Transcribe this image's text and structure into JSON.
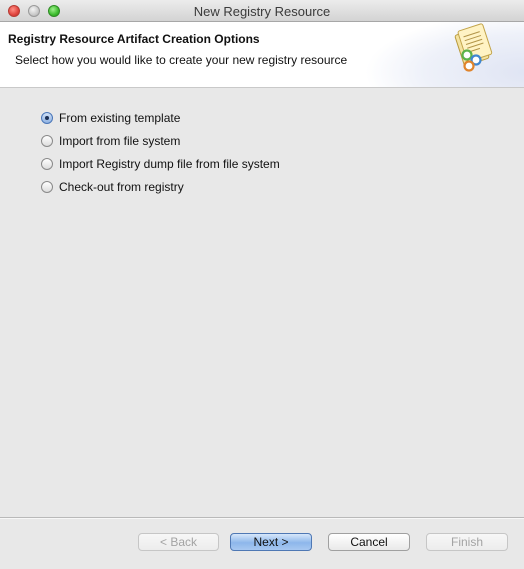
{
  "window": {
    "title": "New Registry Resource"
  },
  "header": {
    "title": "Registry Resource Artifact Creation Options",
    "description": "Select how you would like to create your new registry resource",
    "icon": "registry-documents-icon"
  },
  "options": [
    {
      "label": "From existing template",
      "selected": true
    },
    {
      "label": "Import from file system",
      "selected": false
    },
    {
      "label": "Import Registry dump file from file system",
      "selected": false
    },
    {
      "label": "Check-out from registry",
      "selected": false
    }
  ],
  "buttons": {
    "back": "< Back",
    "next": "Next >",
    "cancel": "Cancel",
    "finish": "Finish"
  },
  "colors": {
    "accent": "#8db7eb",
    "background": "#e8e8e8"
  }
}
